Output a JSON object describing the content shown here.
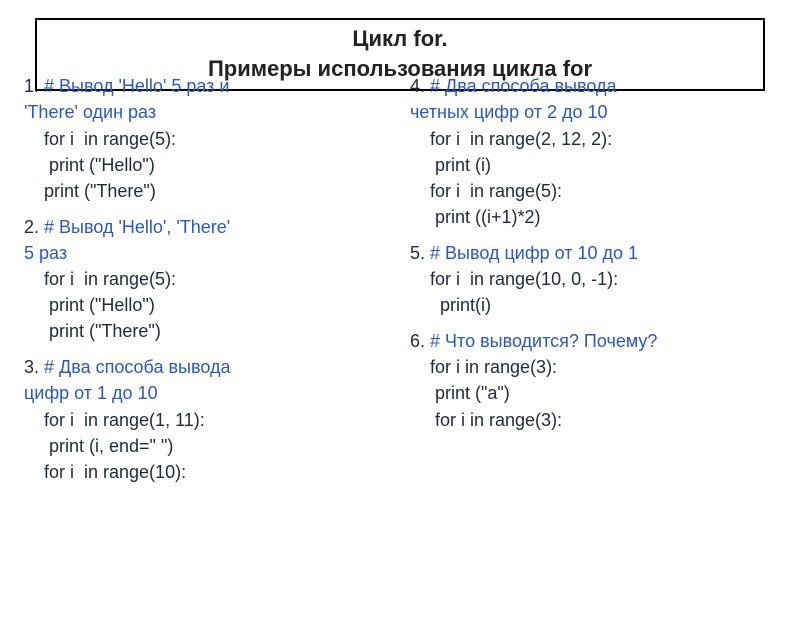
{
  "title": {
    "line1": "Цикл for.",
    "line2": "Примеры использования цикла for"
  },
  "left": {
    "b1": {
      "num": "1. ",
      "c1": "# Вывод 'Hello' 5 раз и",
      "c2": "         'There' один раз",
      "code": "    for i  in range(5):\n     print (\"Hello\")\n    print (\"There\")"
    },
    "b2": {
      "num": "2. ",
      "c1": "# Вывод 'Hello', 'There'",
      "c2": "      5 раз",
      "code": "    for i  in range(5):\n     print (\"Hello\")\n     print (\"There\")"
    },
    "b3": {
      "num": "3. ",
      "c1": "# Два способа вывода",
      "c2": "      цифр от 1 до 10",
      "code": "    for i  in range(1, 11):\n     print (i, end=\" \")\n    for i  in range(10):"
    }
  },
  "right": {
    "b4": {
      "num": "4. ",
      "c1": "# Два способа вывода",
      "c2": "      четных цифр от 2 до 10",
      "code": "    for i  in range(2, 12, 2):\n     print (i)\n    for i  in range(5):\n     print ((i+1)*2)"
    },
    "b5": {
      "num": "5. ",
      "c1": "# Вывод цифр от 10 до 1",
      "code": "    for i  in range(10, 0, -1):\n      print(i)"
    },
    "b6": {
      "num": "6. ",
      "c1": "# Что выводится? Почему?",
      "code": "    for i in range(3):\n     print (\"a\")\n     for i in range(3):"
    }
  }
}
